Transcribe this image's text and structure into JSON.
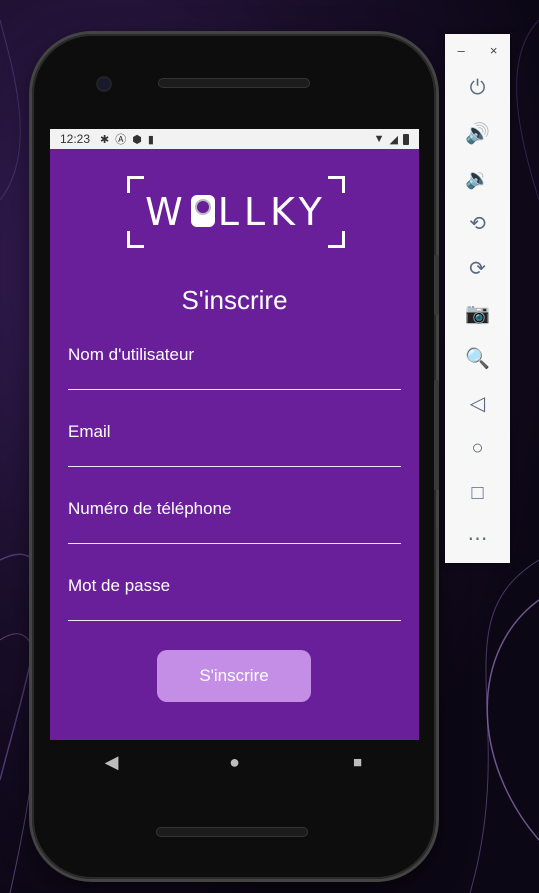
{
  "status_bar": {
    "time": "12:23",
    "left_icons": [
      "gear-icon",
      "a-circle-icon",
      "play-shield-icon",
      "sd-card-icon"
    ],
    "right_icons": [
      "wifi-icon",
      "signal-icon",
      "battery-icon"
    ]
  },
  "app": {
    "logo_text_left": "W",
    "logo_text_right": "LLKY",
    "title": "S'inscrire",
    "fields": {
      "username_placeholder": "Nom d'utilisateur",
      "email_placeholder": "Email",
      "phone_placeholder": "Numéro de téléphone",
      "password_placeholder": "Mot de passe"
    },
    "submit_label": "S'inscrire",
    "colors": {
      "background": "#6a1f9a",
      "button": "#c48ee6"
    }
  },
  "nav_bar": {
    "back": "◀",
    "home": "●",
    "recents": "■"
  },
  "emulator_toolbar": {
    "minimize": "–",
    "close": "×",
    "items": [
      "power-icon",
      "volume-up-icon",
      "volume-down-icon",
      "rotate-left-icon",
      "rotate-right-icon",
      "camera-icon",
      "zoom-icon",
      "back-icon",
      "home-icon",
      "overview-icon",
      "more-icon"
    ]
  }
}
